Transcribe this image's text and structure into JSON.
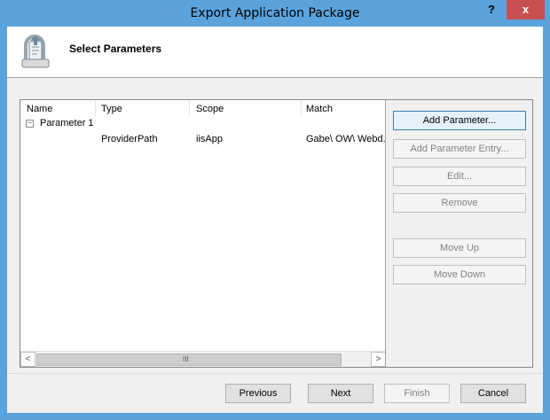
{
  "window": {
    "title": "Export Application Package",
    "help_label": "?",
    "close_label": "x"
  },
  "header": {
    "title": "Select Parameters",
    "icon": "package-export-icon"
  },
  "table": {
    "columns": [
      "Name",
      "Type",
      "Scope",
      "Match"
    ],
    "parameter": {
      "name": "Parameter 1",
      "toggle": "−"
    },
    "entry": {
      "type": "ProviderPath",
      "scope": "iisApp",
      "match": "Gabe\\ OW\\ Webd."
    },
    "scroll_left": "<",
    "scroll_right": ">",
    "scroll_grip": "III"
  },
  "side_buttons": {
    "add_parameter": "Add Parameter...",
    "add_parameter_entry": "Add Parameter Entry...",
    "edit": "Edit...",
    "remove": "Remove",
    "move_up": "Move Up",
    "move_down": "Move Down"
  },
  "footer": {
    "previous": "Previous",
    "next": "Next",
    "finish": "Finish",
    "cancel": "Cancel"
  },
  "colors": {
    "frame": "#5ba3dc",
    "close": "#c75050",
    "dialog_bg": "#f0f0f0"
  }
}
